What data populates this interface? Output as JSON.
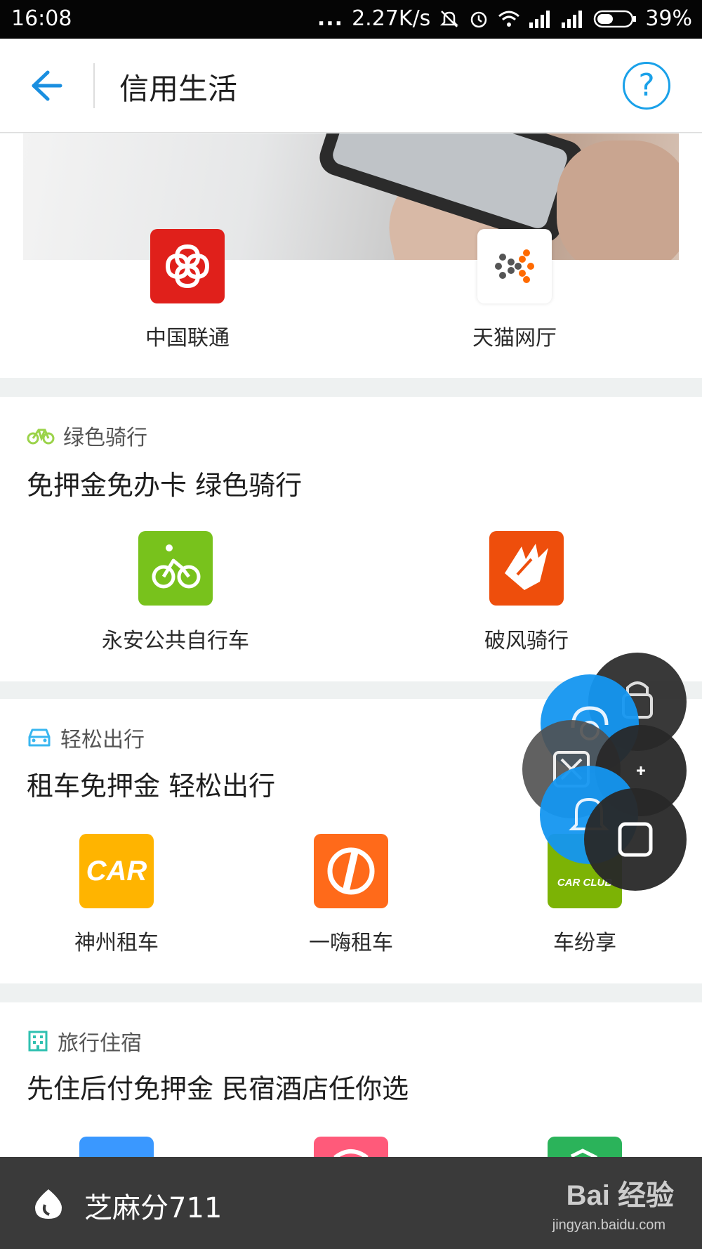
{
  "status_bar": {
    "time": "16:08",
    "dots": "...",
    "network_speed": "2.27K/s",
    "battery": "39%"
  },
  "header": {
    "title": "信用生活",
    "help_symbol": "?"
  },
  "top_section": {
    "apps": [
      {
        "label": "中国联通",
        "icon": "china-unicom-icon",
        "color": "#e0201b"
      },
      {
        "label": "天猫网厅",
        "icon": "tmall-hall-icon",
        "color": "#ffffff"
      }
    ]
  },
  "bike_section": {
    "category": "绿色骑行",
    "headline": "免押金免办卡 绿色骑行",
    "apps": [
      {
        "label": "永安公共自行车",
        "icon": "bicycle-icon",
        "color": "#78c21c"
      },
      {
        "label": "破风骑行",
        "icon": "pofeng-icon",
        "color": "#ee4e0c"
      }
    ]
  },
  "car_section": {
    "category": "轻松出行",
    "headline": "租车免押金 轻松出行",
    "apps": [
      {
        "label": "神州租车",
        "icon": "car-logo-icon",
        "color": "#ffb400",
        "logo_text": "CAR"
      },
      {
        "label": "一嗨租车",
        "icon": "ehi-icon",
        "color": "#ff6a1a"
      },
      {
        "label": "车纷享",
        "icon": "car-club-icon",
        "color": "#7cb305",
        "logo_text": "CAR CLUB"
      }
    ]
  },
  "hotel_section": {
    "category": "旅行住宿",
    "headline": "先住后付免押金 民宿酒店任你选",
    "apps": [
      {
        "icon": "hotel-app-1-icon",
        "color": "#3a98ff"
      },
      {
        "icon": "hotel-app-2-icon",
        "color": "#ff5a7a"
      },
      {
        "icon": "hotel-app-3-icon",
        "color": "#2bb35a"
      }
    ]
  },
  "bottom_bar": {
    "score_label": "芝麻分711",
    "watermark": "Bai 经验",
    "watermark_url": "jingyan.baidu.com"
  },
  "colors": {
    "accent": "#1aa1e9",
    "bike_green": "#9bd34a",
    "car_blue": "#38b6f0",
    "hotel_teal": "#2fc0b0"
  }
}
